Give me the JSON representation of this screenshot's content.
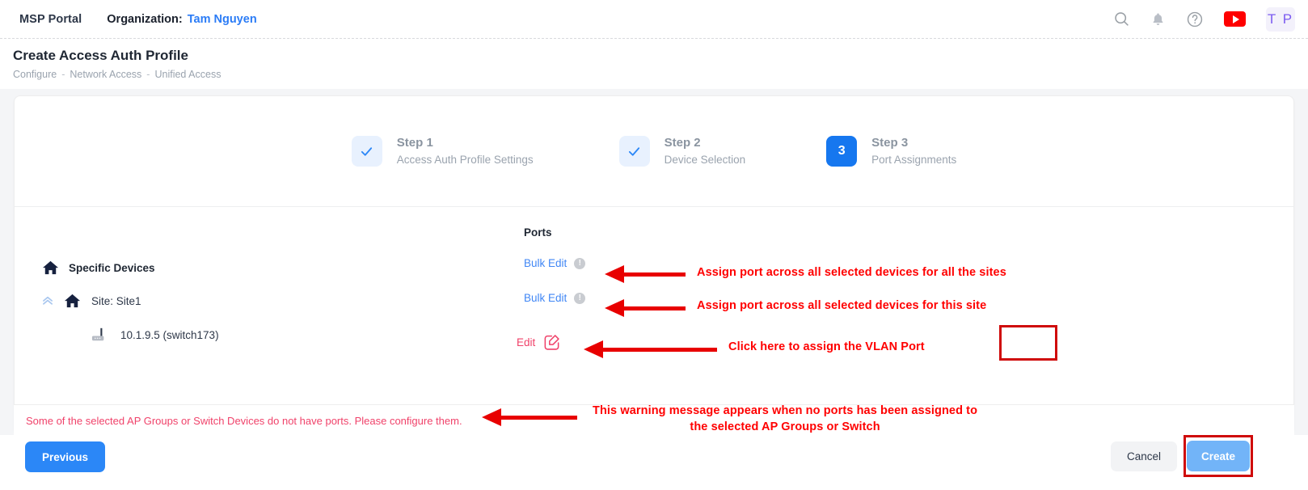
{
  "topbar": {
    "msp_portal": "MSP Portal",
    "organization_label": "Organization:",
    "organization_value": "Tam Nguyen",
    "icons": [
      "search-icon",
      "bell-icon",
      "help-icon",
      "youtube-icon"
    ],
    "avatar_initials": "T P"
  },
  "header": {
    "title": "Create Access Auth Profile",
    "breadcrumbs": [
      "Configure",
      "Network Access",
      "Unified Access"
    ],
    "breadcrumb_separator": "-"
  },
  "stepper": {
    "steps": [
      {
        "name": "Step 1",
        "sub": "Access Auth Profile Settings",
        "state": "done",
        "badge": "check"
      },
      {
        "name": "Step 2",
        "sub": "Device Selection",
        "state": "done",
        "badge": "check"
      },
      {
        "name": "Step 3",
        "sub": "Port Assignments",
        "state": "active",
        "badge": "3"
      }
    ]
  },
  "main": {
    "ports_header": "Ports",
    "tree": [
      {
        "label": "Specific Devices",
        "icon": "home-icon",
        "chevron": false
      },
      {
        "label": "Site: Site1",
        "icon": "home-icon",
        "chevron": true
      },
      {
        "label": "10.1.9.5 (switch173)",
        "icon": "switch-icon",
        "chevron": false
      }
    ],
    "ports": [
      {
        "label": "Bulk Edit",
        "info": "!"
      },
      {
        "label": "Bulk Edit",
        "info": "!"
      },
      {
        "label": "Edit",
        "icon": "edit-square-icon"
      }
    ]
  },
  "warning": {
    "text": "Some of the selected AP Groups or Switch Devices do not have ports. Please configure them."
  },
  "footer": {
    "previous": "Previous",
    "cancel": "Cancel",
    "create": "Create"
  },
  "annotations": {
    "a1": "Assign port across all selected devices for all the sites",
    "a2": "Assign port across all selected devices for this site",
    "a3": "Click here to assign the VLAN Port",
    "a4_line1": "This warning message appears when no ports has been assigned to",
    "a4_line2": "the selected AP Groups or Switch"
  },
  "colors": {
    "accent_blue": "#2b87f7",
    "link_blue": "#4187f5",
    "step_active": "#1677ef",
    "warning_pink": "#f0426a",
    "annotation_red": "#ff0000",
    "highlight_box": "#cf0a0a"
  }
}
